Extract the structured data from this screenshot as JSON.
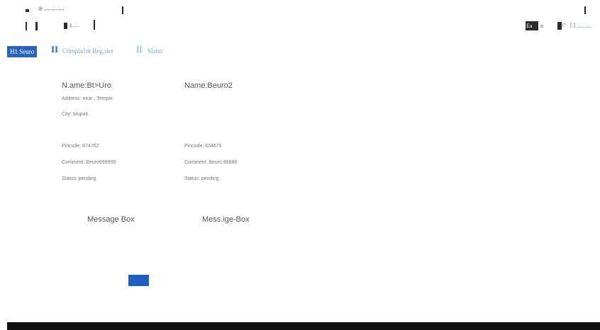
{
  "header": {
    "top_text": "@ ,,,,,,,,,,,,,,,",
    "second_text": "1.....",
    "right_text_a": "Ea",
    "right_text_b": "n",
    "right_text_c": "(\"·",
    "right_link": "11,......."
  },
  "nav": {
    "tabs": [
      {
        "label": "H1 Seuro",
        "active": true
      },
      {
        "label": "C0mpla1nt Reg,sler",
        "active": false
      },
      {
        "label": "Slatin",
        "active": false
      }
    ],
    "separator": "II"
  },
  "complaints": [
    {
      "name": "N.ame:Bt>Uro",
      "address": "Address: near , Temple",
      "city": "City: tirupati",
      "pincode": "Pincode: 874762",
      "comment": "Comment: Beuro999999",
      "status": "Status: pending",
      "message_box": "Message Box"
    },
    {
      "name": "Name:Beuro2",
      "pincode": "Pincode: 834675",
      "comment": "Comment: Beuro 88888",
      "status": "Status: pending",
      "message_box": "Mess.ige-Box"
    }
  ],
  "colors": {
    "accent": "#2a63b8",
    "link": "#7aa3d6",
    "button": "#1f5fbf",
    "footer": "#111111"
  }
}
